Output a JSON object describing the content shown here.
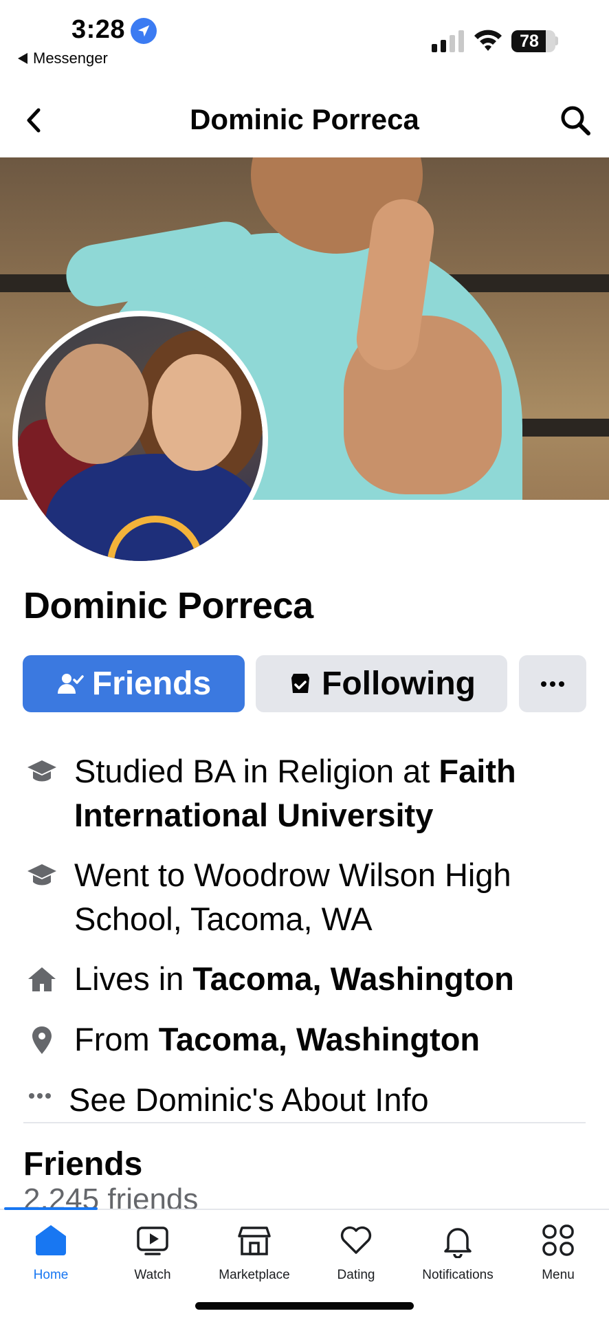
{
  "status_bar": {
    "time": "3:28",
    "back_app": "Messenger",
    "battery": "78",
    "battery_level": 0.78,
    "signal_bars": 2,
    "accent": "#3b7bf2"
  },
  "header": {
    "title": "Dominic Porreca",
    "back_icon": "chevron-left-icon",
    "search_icon": "search-icon"
  },
  "profile": {
    "name": "Dominic Porreca",
    "actions": {
      "friends_label": "Friends",
      "following_label": "Following",
      "more_label": "···"
    },
    "details": [
      {
        "icon": "graduation-cap-icon",
        "prefix": "Studied BA in Religion at ",
        "bold": "Faith International University"
      },
      {
        "icon": "graduation-cap-icon",
        "prefix": "Went to Woodrow Wilson High School, Tacoma, WA",
        "bold": ""
      },
      {
        "icon": "home-icon",
        "prefix": "Lives in ",
        "bold": "Tacoma, Washington"
      },
      {
        "icon": "location-pin-icon",
        "prefix": "From ",
        "bold": "Tacoma, Washington"
      }
    ],
    "see_about": "See Dominic's About Info"
  },
  "friends": {
    "title": "Friends",
    "count": "2,245 friends"
  },
  "tabbar": {
    "tabs": [
      {
        "label": "Home",
        "icon": "home-icon",
        "active": true
      },
      {
        "label": "Watch",
        "icon": "video-play-icon",
        "active": false
      },
      {
        "label": "Marketplace",
        "icon": "storefront-icon",
        "active": false
      },
      {
        "label": "Dating",
        "icon": "heart-icon",
        "active": false
      },
      {
        "label": "Notifications",
        "icon": "bell-icon",
        "active": false
      },
      {
        "label": "Menu",
        "icon": "grid-menu-icon",
        "active": false
      }
    ]
  },
  "colors": {
    "primary": "#3b79e0",
    "active_tab": "#1877f2",
    "button_gray": "#e4e6eb"
  }
}
